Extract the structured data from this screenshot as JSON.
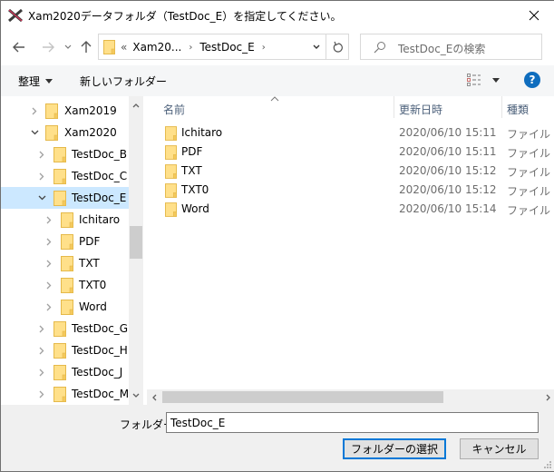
{
  "window": {
    "title": "Xam2020データフォルダ（TestDoc_E）を指定してください。"
  },
  "nav": {
    "back_label": "←",
    "forward_label": "→",
    "recent_label": "˅",
    "up_label": "↑",
    "breadcrumb": {
      "overflow": "«",
      "items": [
        "Xam20...",
        "TestDoc_E"
      ]
    },
    "search_placeholder": "TestDoc_Eの検索"
  },
  "commandbar": {
    "organize_label": "整理",
    "new_folder_label": "新しいフォルダー",
    "help_label": "?"
  },
  "tree": {
    "items": [
      {
        "label": "Xam2019",
        "level": 1,
        "expanded": false,
        "selected": false
      },
      {
        "label": "Xam2020",
        "level": 1,
        "expanded": true,
        "selected": false
      },
      {
        "label": "TestDoc_B",
        "level": 2,
        "expanded": false,
        "selected": false
      },
      {
        "label": "TestDoc_C",
        "level": 2,
        "expanded": false,
        "selected": false
      },
      {
        "label": "TestDoc_E",
        "level": 2,
        "expanded": true,
        "selected": true
      },
      {
        "label": "Ichitaro",
        "level": 3,
        "expanded": false,
        "selected": false
      },
      {
        "label": "PDF",
        "level": 3,
        "expanded": false,
        "selected": false
      },
      {
        "label": "TXT",
        "level": 3,
        "expanded": false,
        "selected": false
      },
      {
        "label": "TXT0",
        "level": 3,
        "expanded": false,
        "selected": false
      },
      {
        "label": "Word",
        "level": 3,
        "expanded": false,
        "selected": false
      },
      {
        "label": "TestDoc_G",
        "level": 2,
        "expanded": false,
        "selected": false
      },
      {
        "label": "TestDoc_H",
        "level": 2,
        "expanded": false,
        "selected": false
      },
      {
        "label": "TestDoc_J",
        "level": 2,
        "expanded": false,
        "selected": false
      },
      {
        "label": "TestDoc_M",
        "level": 2,
        "expanded": false,
        "selected": false
      }
    ]
  },
  "filelist": {
    "columns": {
      "name": "名前",
      "modified": "更新日時",
      "type": "種類"
    },
    "rows": [
      {
        "name": "Ichitaro",
        "modified": "2020/06/10 15:11",
        "type": "ファイル フォルダー"
      },
      {
        "name": "PDF",
        "modified": "2020/06/10 15:11",
        "type": "ファイル フォルダー"
      },
      {
        "name": "TXT",
        "modified": "2020/06/10 15:12",
        "type": "ファイル フォルダー"
      },
      {
        "name": "TXT0",
        "modified": "2020/06/10 15:12",
        "type": "ファイル フォルダー"
      },
      {
        "name": "Word",
        "modified": "2020/06/10 15:14",
        "type": "ファイル フォルダー"
      }
    ]
  },
  "footer": {
    "folder_label": "フォルダー:",
    "folder_value": "TestDoc_E",
    "select_button": "フォルダーの選択",
    "cancel_button": "キャンセル"
  },
  "colors": {
    "selection": "#cce8ff",
    "accent": "#0078d7",
    "help": "#0f6dbe",
    "folder": "#ffe08a"
  }
}
